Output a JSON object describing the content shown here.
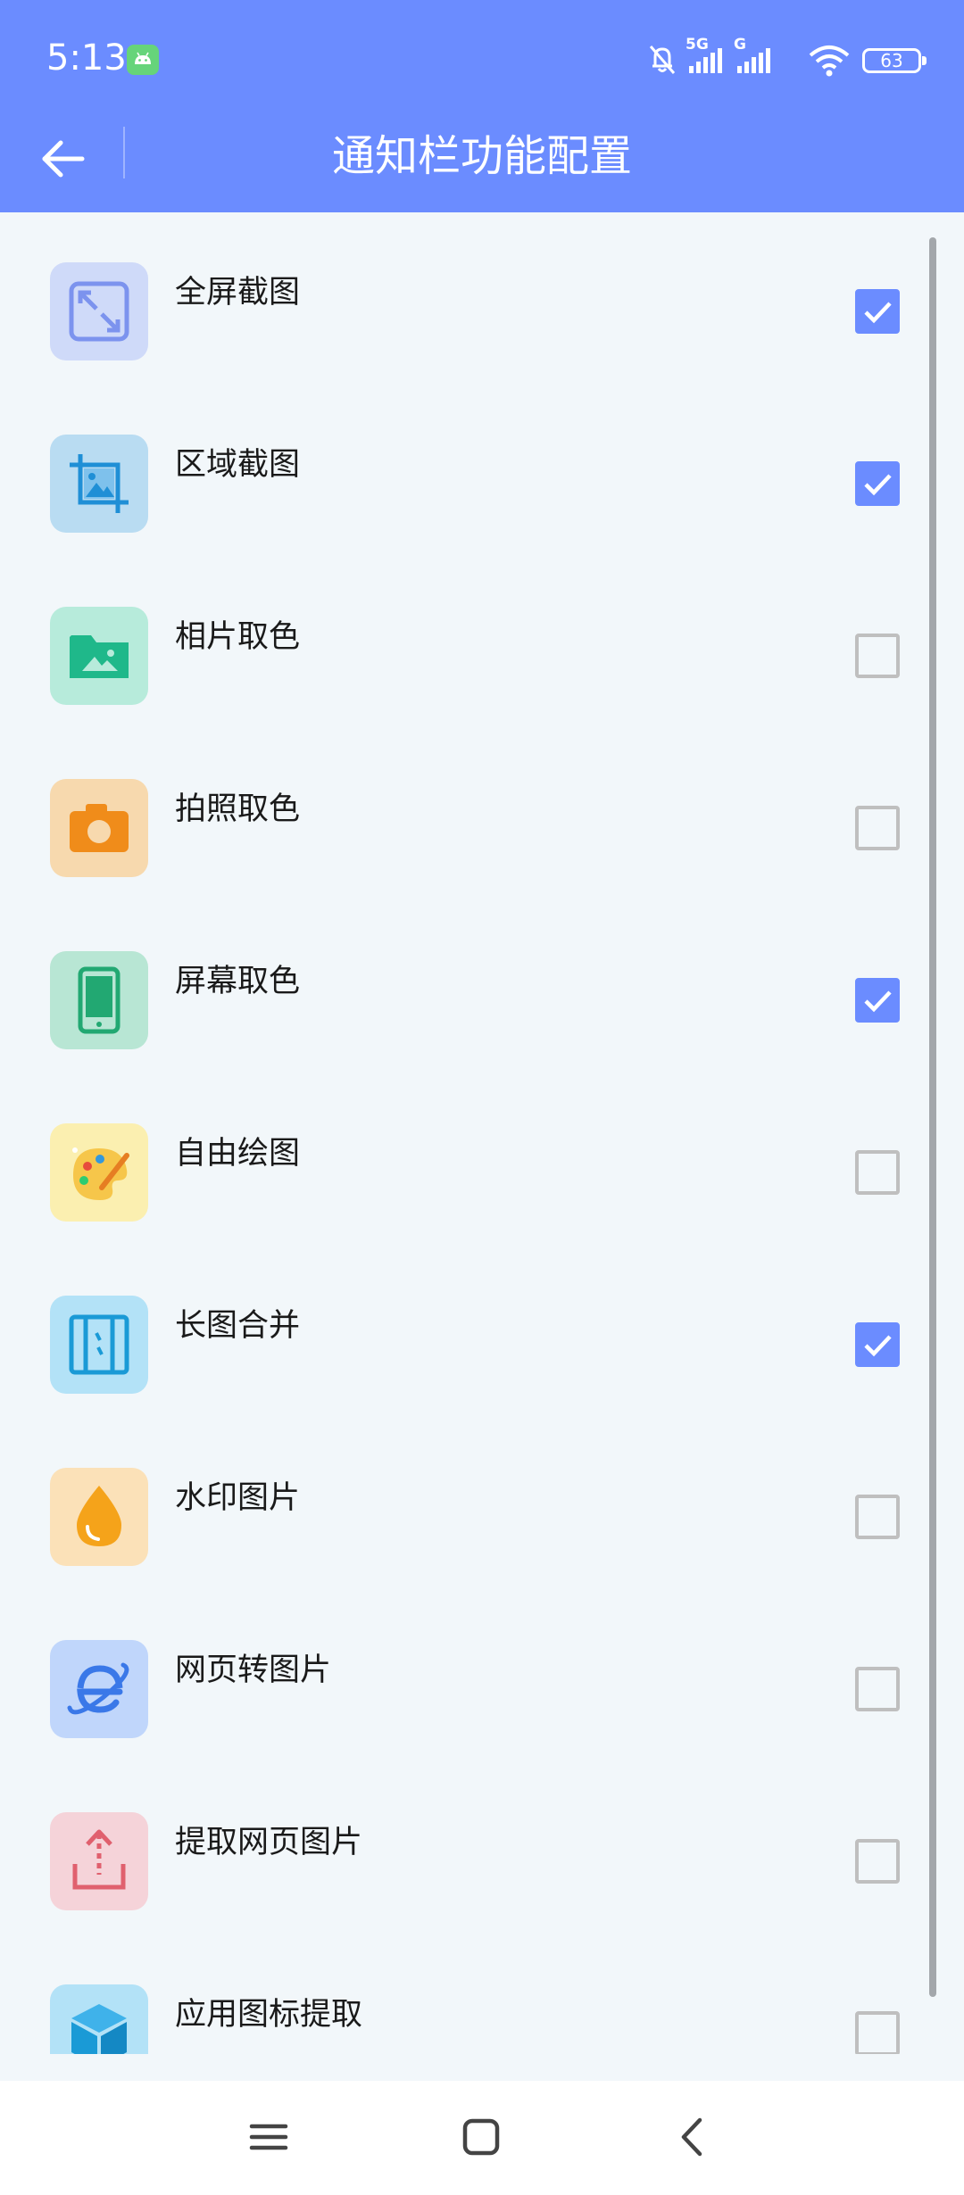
{
  "status_bar": {
    "time": "5:13",
    "network_left": "5G",
    "network_right": "G",
    "battery": "63"
  },
  "header": {
    "title": "通知栏功能配置"
  },
  "colors": {
    "accent": "#6b8cff",
    "background": "#f2f7fa"
  },
  "items": [
    {
      "label": "全屏截图",
      "checked": true,
      "icon": "fullscreen-icon",
      "icon_bg": "#cfdaf9"
    },
    {
      "label": "区域截图",
      "checked": true,
      "icon": "crop-image-icon",
      "icon_bg": "#b9dcf2"
    },
    {
      "label": "相片取色",
      "checked": false,
      "icon": "photo-folder-icon",
      "icon_bg": "#b7ebdb"
    },
    {
      "label": "拍照取色",
      "checked": false,
      "icon": "camera-icon",
      "icon_bg": "#f7d9ae"
    },
    {
      "label": "屏幕取色",
      "checked": true,
      "icon": "phone-icon",
      "icon_bg": "#b8e6d4"
    },
    {
      "label": "自由绘图",
      "checked": false,
      "icon": "palette-icon",
      "icon_bg": "#fbefb0"
    },
    {
      "label": "长图合并",
      "checked": true,
      "icon": "long-image-icon",
      "icon_bg": "#b3e2f7"
    },
    {
      "label": "水印图片",
      "checked": false,
      "icon": "water-drop-icon",
      "icon_bg": "#fbe1b8"
    },
    {
      "label": "网页转图片",
      "checked": false,
      "icon": "browser-icon",
      "icon_bg": "#c0d6fb"
    },
    {
      "label": "提取网页图片",
      "checked": false,
      "icon": "upload-icon",
      "icon_bg": "#f5d3d9"
    },
    {
      "label": "应用图标提取",
      "checked": false,
      "icon": "cube-icon",
      "icon_bg": "#b3e2f7"
    }
  ]
}
